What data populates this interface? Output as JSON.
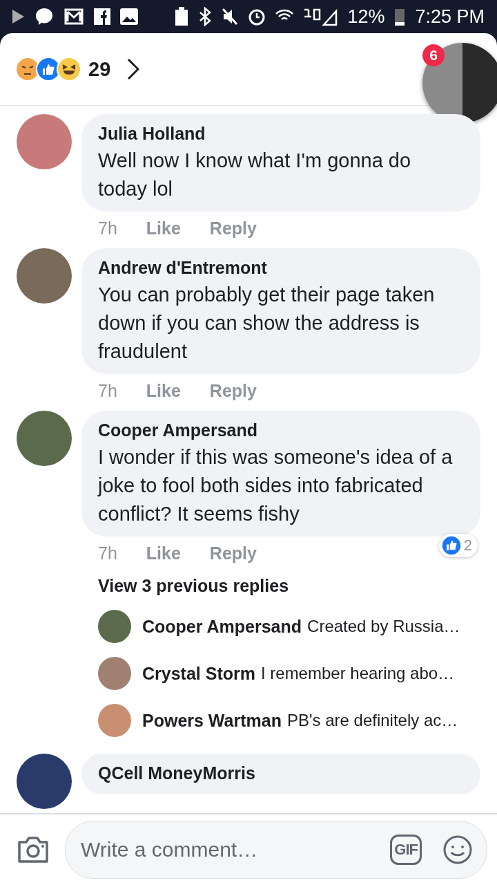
{
  "status_bar": {
    "battery": "12%",
    "time": "7:25 PM"
  },
  "header": {
    "reaction_count": "29"
  },
  "chat_head": {
    "badge": "6"
  },
  "comments": [
    {
      "name": "Julia Holland",
      "text": "Well now I know what I'm gonna do today lol",
      "time": "7h",
      "like": "Like",
      "reply": "Reply"
    },
    {
      "name": "Andrew d'Entremont",
      "text": "You can probably get their page taken down if you can show the address is fraudulent",
      "time": "7h",
      "like": "Like",
      "reply": "Reply"
    },
    {
      "name": "Cooper Ampersand",
      "text": "I wonder if this was someone's idea of a joke to fool both sides into fabricated conflict? It seems fishy",
      "time": "7h",
      "like": "Like",
      "reply": "Reply",
      "reactions": "2",
      "view_replies": "View 3 previous replies",
      "replies": [
        {
          "name": "Cooper Ampersand",
          "text": "Created by Russia…"
        },
        {
          "name": "Crystal Storm",
          "text": "I remember hearing abo…"
        },
        {
          "name": "Powers Wartman",
          "text": "PB's are definitely ac…"
        }
      ]
    },
    {
      "name": "QCell MoneyMorris"
    }
  ],
  "composer": {
    "placeholder": "Write a comment…",
    "gif": "GIF"
  }
}
